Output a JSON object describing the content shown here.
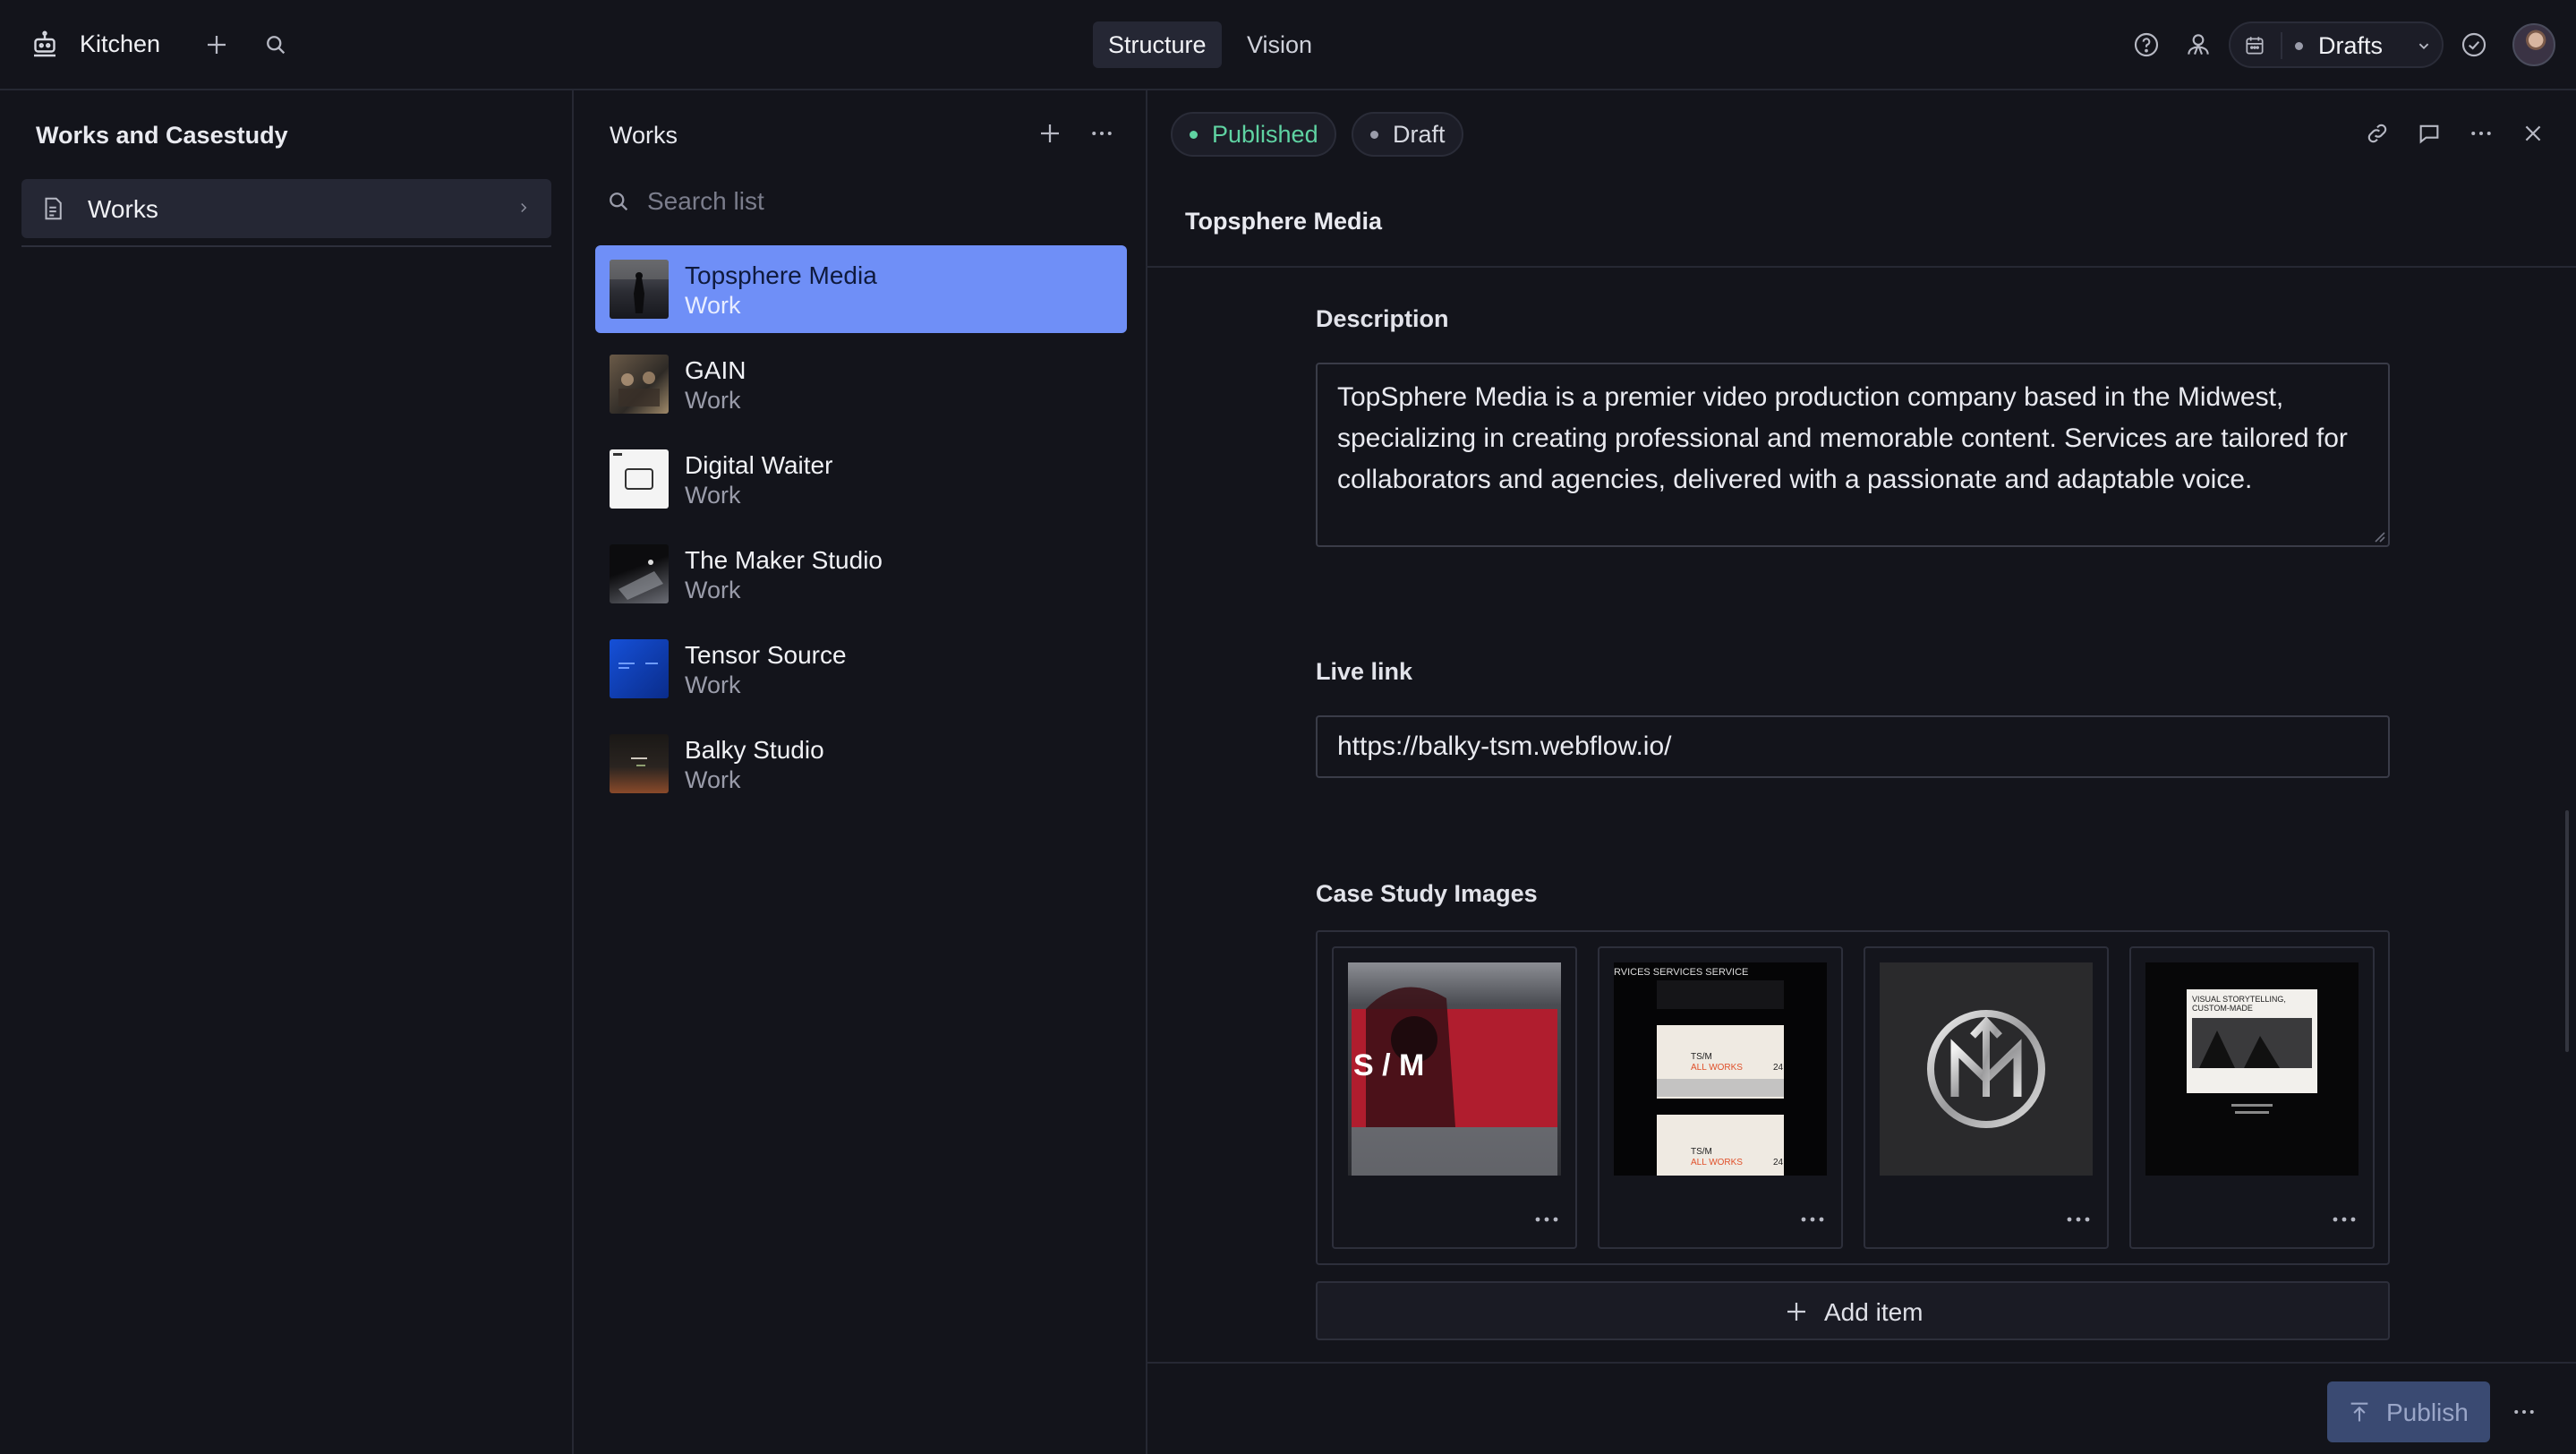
{
  "topbar": {
    "app_name": "Kitchen",
    "tabs": [
      {
        "label": "Structure",
        "active": true
      },
      {
        "label": "Vision",
        "active": false
      }
    ],
    "release": {
      "label": "Drafts"
    }
  },
  "pane1": {
    "title": "Works and Casestudy",
    "items": [
      {
        "label": "Works",
        "icon": "document-icon"
      }
    ]
  },
  "pane2": {
    "title": "Works",
    "search_placeholder": "Search list",
    "documents": [
      {
        "title": "Topsphere Media",
        "subtitle": "Work",
        "selected": true
      },
      {
        "title": "GAIN",
        "subtitle": "Work",
        "selected": false
      },
      {
        "title": "Digital Waiter",
        "subtitle": "Work",
        "selected": false
      },
      {
        "title": "The Maker Studio",
        "subtitle": "Work",
        "selected": false
      },
      {
        "title": "Tensor Source",
        "subtitle": "Work",
        "selected": false
      },
      {
        "title": "Balky Studio",
        "subtitle": "Work",
        "selected": false
      }
    ]
  },
  "editor": {
    "status_published": "Published",
    "status_draft": "Draft",
    "document_title": "Topsphere Media",
    "description_label": "Description",
    "description_value": "TopSphere Media is a premier video production company based in the Midwest, specializing in creating professional and memorable content. Services are tailored for collaborators and agencies, delivered with a passionate and adaptable voice.",
    "live_link_label": "Live link",
    "live_link_value": "https://balky-tsm.webflow.io/",
    "case_study_label": "Case Study Images",
    "case_study_images": [
      {
        "overlay_text": "S  /  M"
      },
      {
        "overlay_text_top": "RVICES  SERVICES  SERVICE",
        "overlay_text_1": "TS/M",
        "overlay_text_2": "ALL WORKS",
        "overlay_number": "24"
      },
      {
        "overlay_text": ""
      },
      {
        "overlay_text_1": "VISUAL STORYTELLING,",
        "overlay_text_2": "CUSTOM-MADE"
      }
    ],
    "add_item_label": "Add item",
    "publish_label": "Publish"
  },
  "colors": {
    "background": "#13141b",
    "accent_selected": "#6f8ff7",
    "published_green": "#5fd3a2",
    "publish_button": "#3a4a72"
  }
}
